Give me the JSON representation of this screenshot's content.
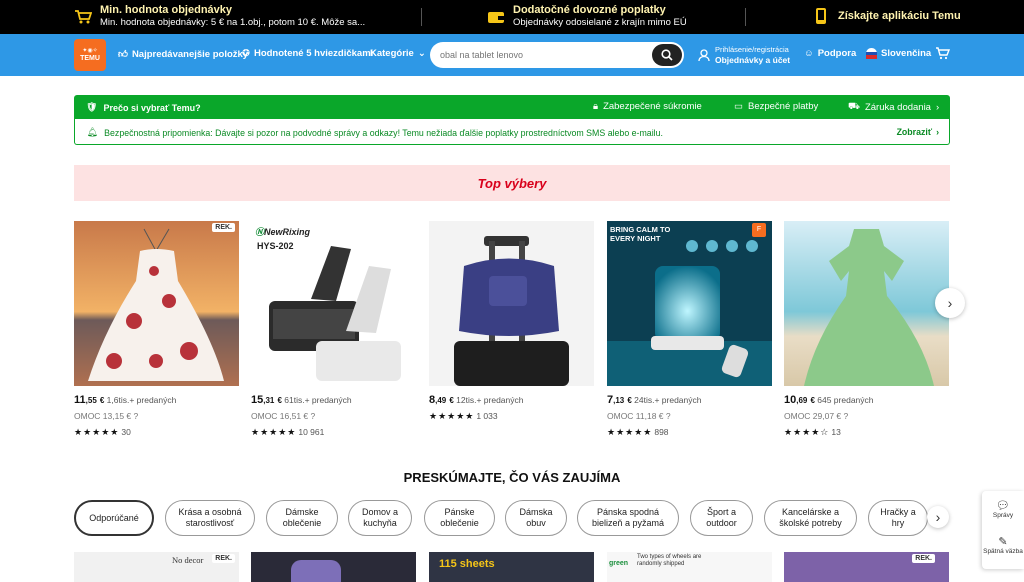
{
  "topbar": {
    "min_order_title": "Min. hodnota objednávky",
    "min_order_sub": "Min. hodnota objednávky: 5 € na 1.obj., potom 10 €. Môže sa...",
    "fees_title": "Dodatočné dovozné poplatky",
    "fees_sub": "Objednávky odosielané z krajín mimo EÚ",
    "app_label": "Získajte aplikáciu Temu"
  },
  "nav": {
    "logo_text": "TEMU",
    "bestsellers": "Najpredávanejšie položky",
    "five_stars": "Hodnotené 5 hviezdičkami",
    "categories": "Kategórie",
    "search_placeholder": "obal na tablet lenovo",
    "account_small": "Prihlásenie/registrácia",
    "account_big": "Objednávky a účet",
    "support": "Podpora",
    "language": "Slovenčina"
  },
  "why": {
    "title": "Prečo si vybrať Temu?",
    "item1": "Zabezpečené súkromie",
    "item2": "Bezpečné platby",
    "item3": "Záruka dodania"
  },
  "notice": {
    "text": "Bezpečnostná pripomienka: Dávajte si pozor na podvodné správy a odkazy! Temu nežiada ďalšie poplatky prostredníctvom SMS alebo e-mailu.",
    "more": "Zobraziť"
  },
  "top_picks": {
    "title": "Top výbery"
  },
  "products": [
    {
      "price_int": "11",
      "price_dec": ",55",
      "currency": "€",
      "sold": "1,6tis.+ predaných",
      "rrp": "OMOC 13,15 €",
      "stars": "★★★★★",
      "rating_value": 4.5,
      "reviews": "30",
      "badge": "REK."
    },
    {
      "price_int": "15",
      "price_dec": ",31",
      "currency": "€",
      "sold": "61tis.+ predaných",
      "rrp": "OMOC 16,51 €",
      "stars": "★★★★★",
      "rating_value": 5,
      "reviews": "10 961",
      "brand": "NewRixing",
      "model": "HYS-202"
    },
    {
      "price_int": "8",
      "price_dec": ",49",
      "currency": "€",
      "sold": "12tis.+ predaných",
      "rrp": "",
      "stars": "★★★★★",
      "rating_value": 4.5,
      "reviews": "1 033"
    },
    {
      "price_int": "7",
      "price_dec": ",13",
      "currency": "€",
      "sold": "24tis.+ predaných",
      "rrp": "OMOC 11,18 €",
      "stars": "★★★★★",
      "rating_value": 5,
      "reviews": "898",
      "overlay": "BRING CALM TO EVERY NIGHT"
    },
    {
      "price_int": "10",
      "price_dec": ",69",
      "currency": "€",
      "sold": "645 predaných",
      "rrp": "OMOC 29,07 €",
      "stars": "★★★★☆",
      "rating_value": 4,
      "reviews": "13"
    }
  ],
  "explore": {
    "title": "PRESKÚMAJTE, ČO VÁS ZAUJÍMA",
    "chips": [
      "Odporúčané",
      "Krása a osobná starostlivosť",
      "Dámske oblečenie",
      "Domov a kuchyňa",
      "Pánske oblečenie",
      "Dámska obuv",
      "Pánska spodná bielizeň a pyžamá",
      "Šport a outdoor",
      "Kancelárske a školské potreby",
      "Hračky a hry"
    ]
  },
  "thumbs": {
    "t1_text": "No decor",
    "t1_badge": "REK.",
    "t3_text": "115 sheets",
    "t4_text": "Two types of wheels are randomly shipped",
    "t4_green": "green",
    "t5_badge": "REK."
  },
  "side_tools": {
    "messages": "Správy",
    "feedback": "Spätná väzba"
  },
  "colors": {
    "nav_blue": "#2e98e6",
    "accent_orange": "#f56d20",
    "green": "#0aa72a",
    "red": "#d9001b"
  }
}
